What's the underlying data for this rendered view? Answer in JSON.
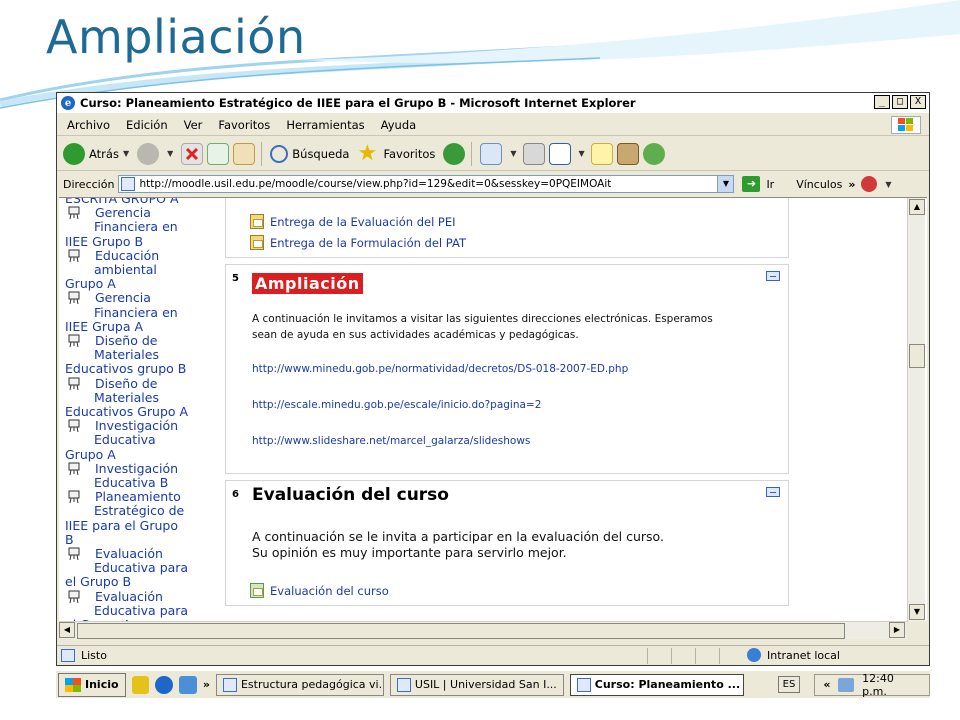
{
  "slide": {
    "title": "Ampliación"
  },
  "window": {
    "title": "Curso: Planeamiento Estratégico de IIEE para el Grupo B - Microsoft Internet Explorer",
    "controls": [
      "_",
      "□",
      "X"
    ]
  },
  "menu": [
    "Archivo",
    "Edición",
    "Ver",
    "Favoritos",
    "Herramientas",
    "Ayuda"
  ],
  "toolbar": {
    "back": "Atrás",
    "search": "Búsqueda",
    "favorites": "Favoritos"
  },
  "address": {
    "label": "Dirección",
    "url": "http://moodle.usil.edu.pe/moodle/course/view.php?id=129&edit=0&sesskey=0PQEIMOAit",
    "go": "Ir",
    "links": "Vínculos"
  },
  "left_nav": {
    "top_partial": "ESCRITA GRUPO A",
    "items": [
      {
        "line1": "Gerencia",
        "rest": [
          "Financiera en",
          "IIEE Grupo B"
        ]
      },
      {
        "line1": "Educación",
        "rest": [
          "ambiental",
          "Grupo A"
        ]
      },
      {
        "line1": "Gerencia",
        "rest": [
          "Financiera en",
          "IIEE Grupa A"
        ]
      },
      {
        "line1": "Diseño de",
        "rest": [
          "Materiales",
          "Educativos grupo B"
        ]
      },
      {
        "line1": "Diseño de",
        "rest": [
          "Materiales",
          "Educativos Grupo A"
        ]
      },
      {
        "line1": "Investigación",
        "rest": [
          "Educativa",
          "Grupo A"
        ]
      },
      {
        "line1": "Investigación",
        "rest": [
          "Educativa B"
        ]
      },
      {
        "line1": "Planeamiento",
        "rest": [
          "Estratégico de",
          "IIEE para el Grupo",
          "B"
        ]
      },
      {
        "line1": "Evaluación",
        "rest": [
          "Educativa para",
          "el Grupo B"
        ]
      },
      {
        "line1": "Evaluación",
        "rest": [
          "Educativa para",
          "el Grupo A"
        ]
      }
    ]
  },
  "sections": {
    "prev": {
      "resources": [
        "Entrega de la Evaluación del PEI",
        "Entrega de la Formulación del PAT"
      ]
    },
    "s5": {
      "number": "5",
      "title": "Ampliación",
      "text_line1": "A continuación le invitamos a visitar las siguientes direcciones electrónicas. Esperamos",
      "text_line2": "sean de ayuda en sus actividades académicas y pedagógicas.",
      "links": [
        "http://www.minedu.gob.pe/normatividad/decretos/DS-018-2007-ED.php",
        "http://escale.minedu.gob.pe/escale/inicio.do?pagina=2",
        "http://www.slideshare.net/marcel_galarza/slideshows"
      ]
    },
    "s6": {
      "number": "6",
      "title": "Evaluación del curso",
      "text_line1": "A continuación se le invita a participar en la evaluación del curso.",
      "text_line2": "Su opinión es muy importante para servirlo mejor.",
      "resource": "Evaluación del curso"
    }
  },
  "status": {
    "text": "Listo",
    "zone": "Intranet local"
  },
  "taskbar": {
    "start": "Inicio",
    "tasks": [
      "Estructura pedagógica vi...",
      "USIL | Universidad San I...",
      "Curso: Planeamiento ..."
    ],
    "lang": "ES",
    "clock": "12:40 p.m."
  }
}
